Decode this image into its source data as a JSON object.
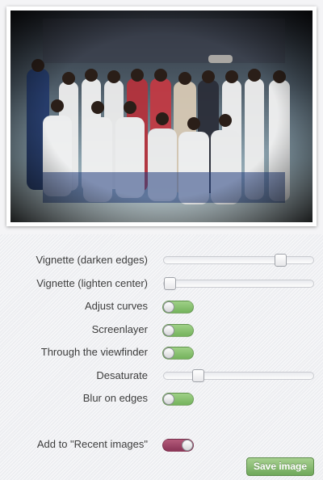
{
  "photo": {
    "description_icon": "group-photo"
  },
  "settings": [
    {
      "label": "Vignette (darken edges)",
      "control": "slider",
      "value_fraction": 0.81
    },
    {
      "label": "Vignette (lighten center)",
      "control": "slider",
      "value_fraction": 0.0
    },
    {
      "label": "Adjust curves",
      "control": "toggle",
      "state": "off"
    },
    {
      "label": "Screenlayer",
      "control": "toggle",
      "state": "off"
    },
    {
      "label": "Through the viewfinder",
      "control": "toggle",
      "state": "off"
    },
    {
      "label": "Desaturate",
      "control": "slider",
      "value_fraction": 0.21
    },
    {
      "label": "Blur on edges",
      "control": "toggle",
      "state": "off"
    }
  ],
  "recent": {
    "label": "Add to \"Recent images\"",
    "state": "on",
    "color": "#8a3456"
  },
  "save_label": "Save image",
  "colors": {
    "toggle_green": "#74b35c",
    "button_green": "#6fa85a"
  }
}
